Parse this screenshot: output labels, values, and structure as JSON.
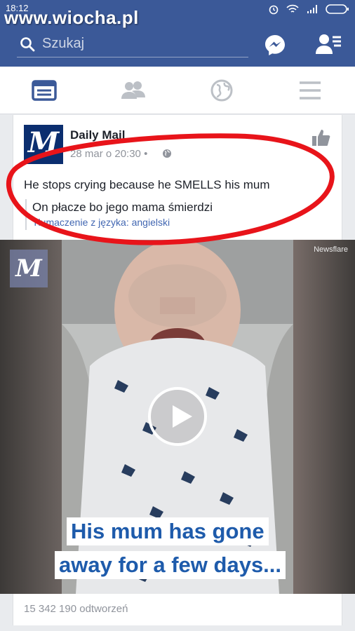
{
  "status_bar": {
    "time": "18:12"
  },
  "watermark": "www.wiocha.pl",
  "search": {
    "placeholder": "Szukaj"
  },
  "post": {
    "page_name": "Daily Mail",
    "date": "28 mar o 20:30",
    "separator": "•",
    "text": "He stops crying because he SMELLS his mum",
    "translation": "On płacze bo jego mama śmierdzi",
    "translation_note": "Tłumaczenie z języka: angielski",
    "views": "15 342 190 odtworzeń"
  },
  "video": {
    "source_label": "Newsflare",
    "caption_line_1": "His mum has gone",
    "caption_line_2": "away for a few days..."
  },
  "colors": {
    "brand": "#3b5998",
    "link": "#4267b2",
    "highlight_ring": "#e8141a",
    "caption_text": "#1e5bab"
  },
  "icons": [
    "search-icon",
    "messenger-icon",
    "friend-requests-icon",
    "news-feed-icon",
    "friends-icon",
    "globe-icon",
    "menu-icon",
    "like-icon",
    "play-icon"
  ]
}
